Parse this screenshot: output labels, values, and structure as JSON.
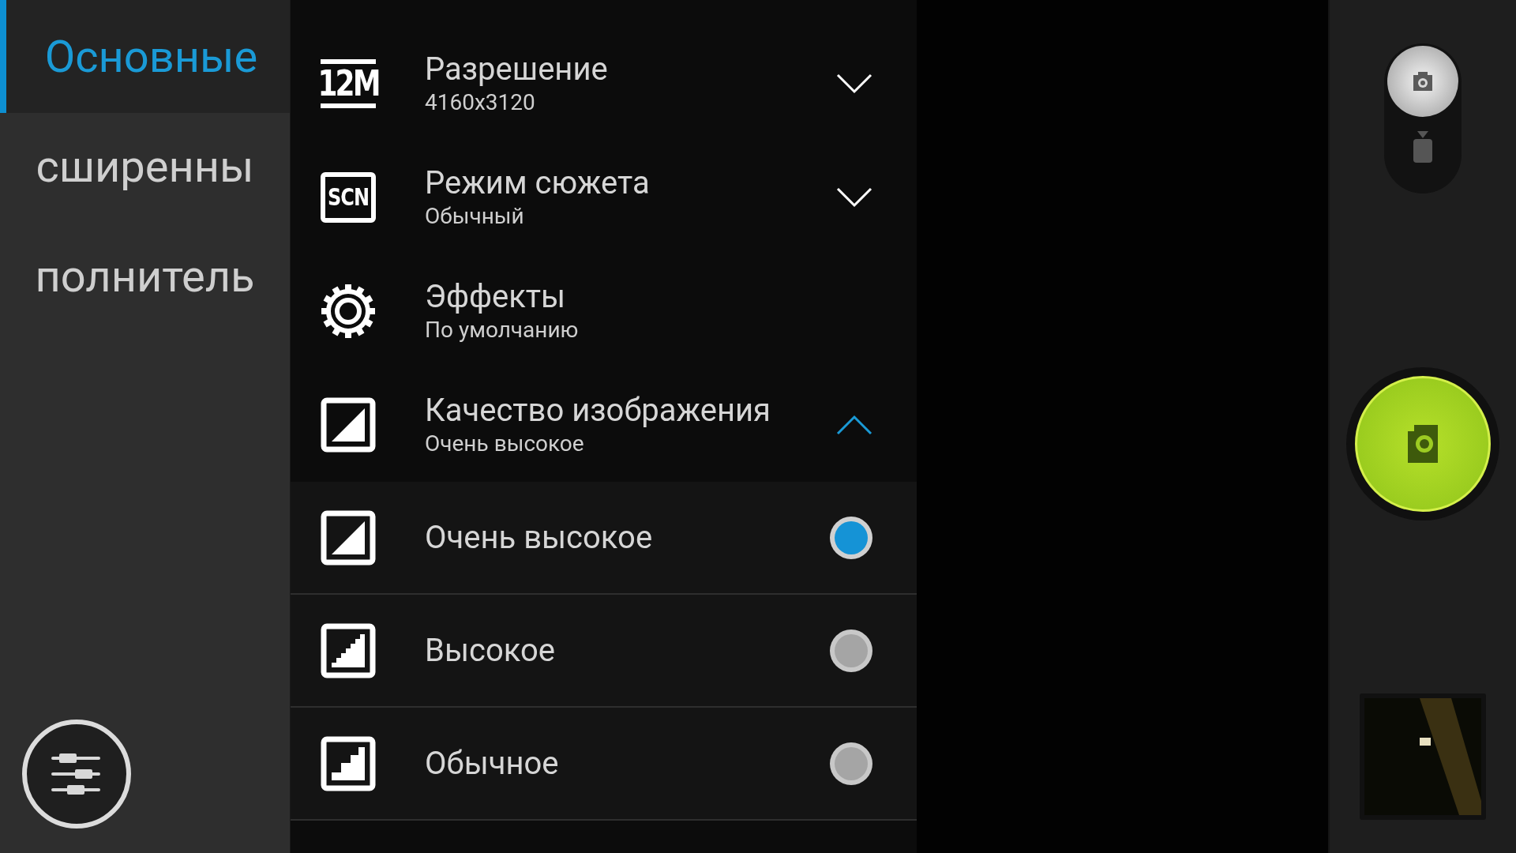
{
  "sidebar": {
    "tabs": [
      {
        "label": "Основные",
        "selected": true
      },
      {
        "label": "сширенны",
        "selected": false
      },
      {
        "label": "полнитель",
        "selected": false
      }
    ]
  },
  "settings": [
    {
      "kind": "resolution",
      "badge": "12M",
      "title": "Разрешение",
      "value": "4160x3120",
      "expanded": false
    },
    {
      "kind": "scene",
      "badge": "SCN",
      "title": "Режим сюжета",
      "value": "Обычный",
      "expanded": false
    },
    {
      "kind": "effects",
      "title": "Эффекты",
      "value": "По умолчанию"
    },
    {
      "kind": "quality",
      "title": "Качество изображения",
      "value": "Очень высокое",
      "expanded": true
    }
  ],
  "mode_switch": {
    "photo_selected": true
  },
  "options": [
    {
      "kind": "very_high",
      "label": "Очень высокое",
      "selected": true
    },
    {
      "kind": "high",
      "label": "Высокое",
      "selected": false
    },
    {
      "kind": "normal",
      "label": "Обычное",
      "selected": false
    }
  ]
}
